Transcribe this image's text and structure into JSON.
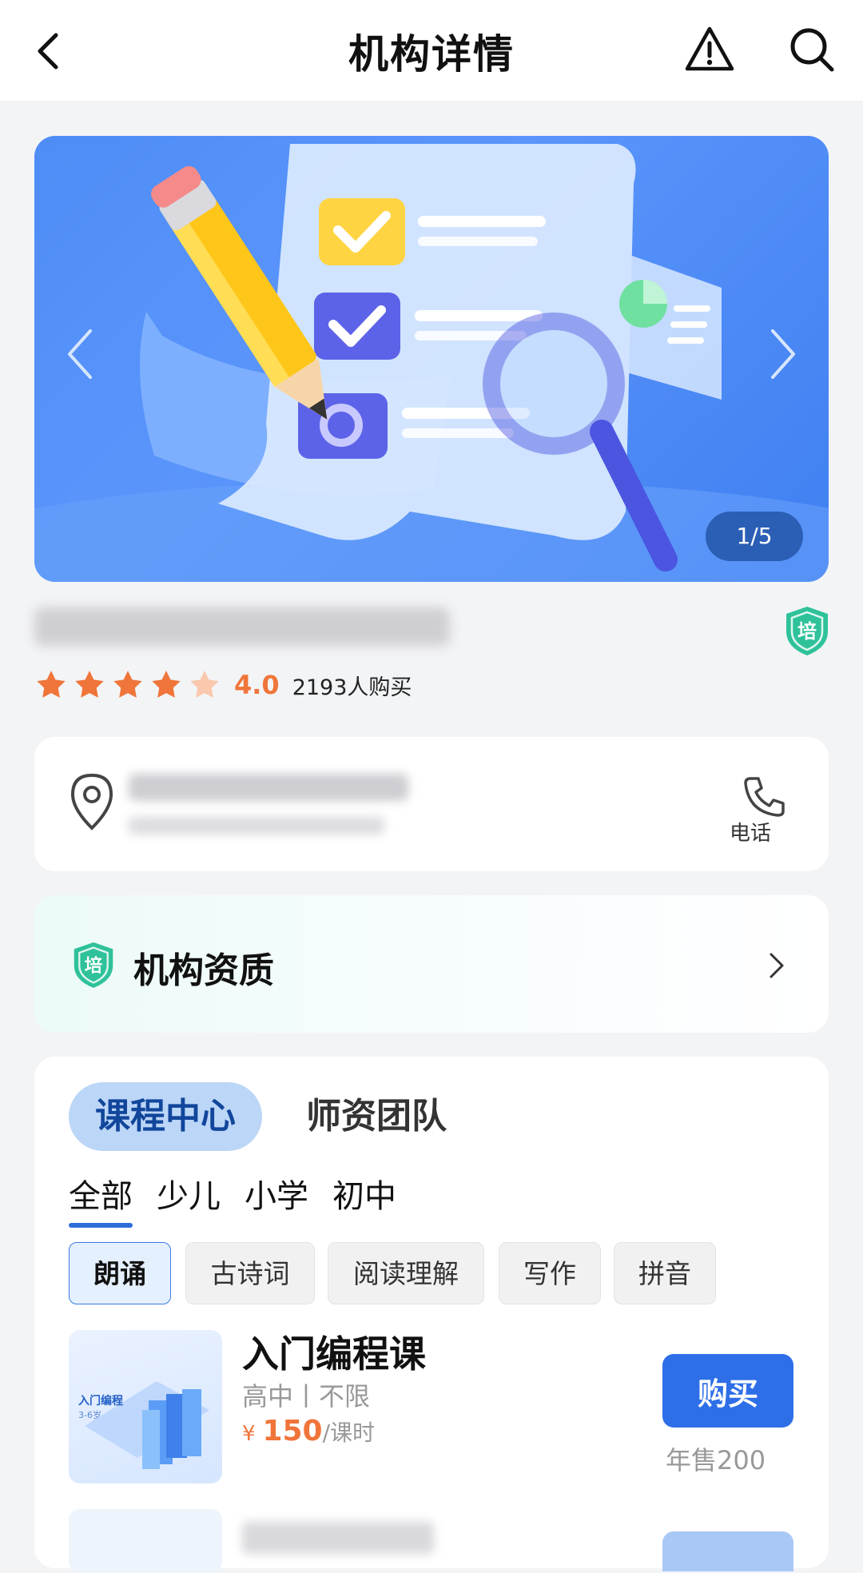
{
  "header": {
    "title": "机构详情"
  },
  "banner": {
    "counter": "1/5"
  },
  "org": {
    "rating": "4.0",
    "stars": 4,
    "buyers": "2193人购买"
  },
  "address": {
    "phone_label": "电话"
  },
  "qualification": {
    "label": "机构资质"
  },
  "courses": {
    "tabs": [
      "课程中心",
      "师资团队"
    ],
    "subtabs": [
      "全部",
      "少儿",
      "小学",
      "初中"
    ],
    "chips": [
      "朗诵",
      "古诗词",
      "阅读理解",
      "写作",
      "拼音"
    ],
    "items": [
      {
        "thumb_title": "入门编程",
        "thumb_sub": "3-6岁",
        "title": "入门编程课",
        "meta": "高中丨不限",
        "currency": "¥",
        "price": "150",
        "unit": "/课时",
        "buy_label": "购买",
        "sales": "年售200"
      }
    ]
  },
  "colors": {
    "accent": "#2e6fe8",
    "star": "#f0753a",
    "tab_active_bg": "#bcd6f7"
  }
}
